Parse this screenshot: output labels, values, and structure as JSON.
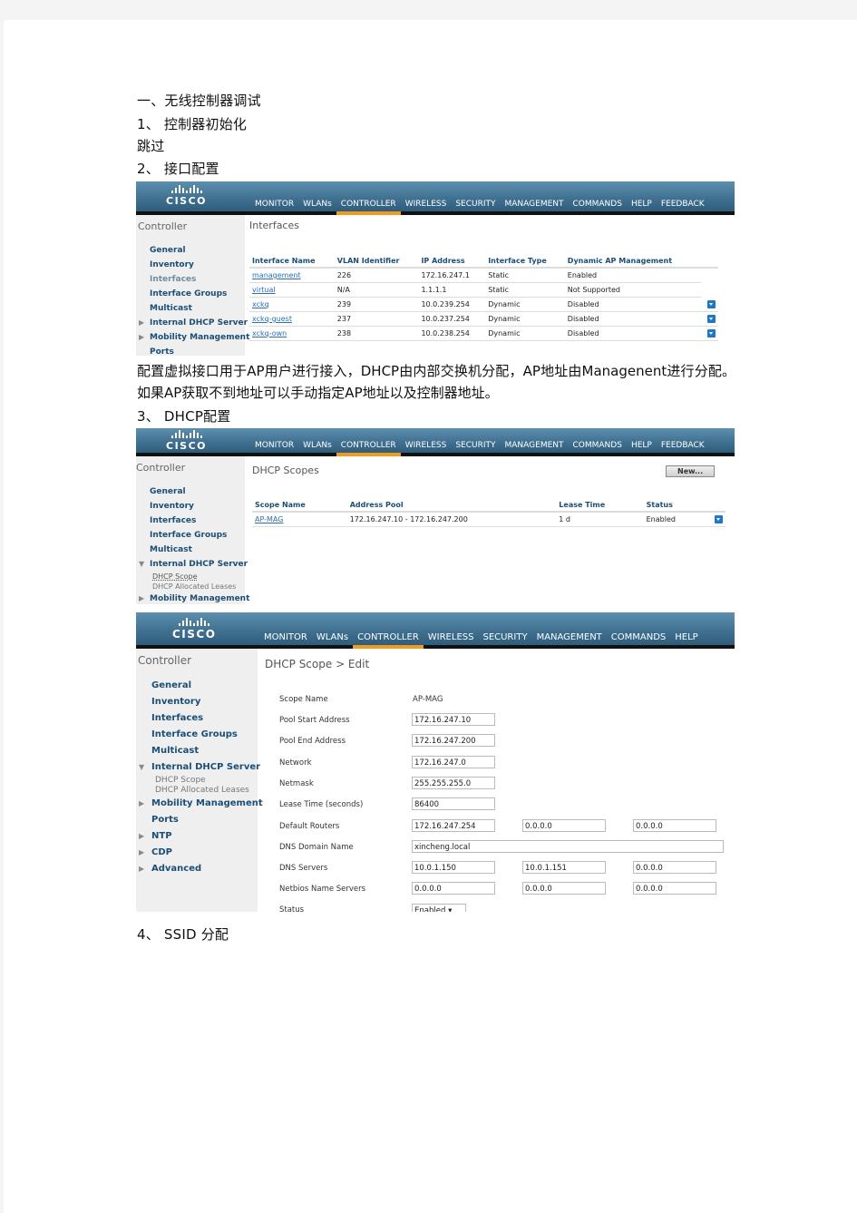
{
  "doc": {
    "heading": "一、无线控制器调试",
    "step1": "1、 控制器初始化",
    "skip": "跳过",
    "step2": "2、 接口配置",
    "para1": "配置虚拟接口用于AP用户进行接入，DHCP由内部交换机分配，AP地址由Managenent进行分配。如果AP获取不到地址可以手动指定AP地址以及控制器地址。",
    "step3": "3、 DHCP配置",
    "step4": "4、 SSID 分配"
  },
  "cisco": {
    "logo_text": "CISCO",
    "menu": [
      "MONITOR",
      "WLANs",
      "CONTROLLER",
      "WIRELESS",
      "SECURITY",
      "MANAGEMENT",
      "COMMANDS",
      "HELP",
      "FEEDBACK"
    ],
    "active_menu": "CONTROLLER",
    "sidebar_title": "Controller"
  },
  "interfaces": {
    "title": "Interfaces",
    "sidebar": [
      "General",
      "Inventory",
      "Interfaces",
      "Interface Groups",
      "Multicast",
      "Internal DHCP Server",
      "Mobility Management",
      "Ports"
    ],
    "columns": [
      "Interface Name",
      "VLAN Identifier",
      "IP Address",
      "Interface Type",
      "Dynamic AP Management"
    ],
    "rows": [
      [
        "management",
        "226",
        "172.16.247.1",
        "Static",
        "Enabled"
      ],
      [
        "virtual",
        "N/A",
        "1.1.1.1",
        "Static",
        "Not Supported"
      ],
      [
        "xckq",
        "239",
        "10.0.239.254",
        "Dynamic",
        "Disabled"
      ],
      [
        "xckq-guest",
        "237",
        "10.0.237.254",
        "Dynamic",
        "Disabled"
      ],
      [
        "xckq-own",
        "238",
        "10.0.238.254",
        "Dynamic",
        "Disabled"
      ]
    ]
  },
  "dhcp_scopes": {
    "title": "DHCP Scopes",
    "new_button": "New...",
    "sidebar": [
      "General",
      "Inventory",
      "Interfaces",
      "Interface Groups",
      "Multicast",
      "Internal DHCP Server"
    ],
    "sub": [
      "DHCP Scope",
      "DHCP Allocated Leases"
    ],
    "sidebar_cut": "Mobility Management",
    "columns": [
      "Scope Name",
      "Address Pool",
      "Lease Time",
      "Status"
    ],
    "rows": [
      [
        "AP-MAG",
        "172.16.247.10 - 172.16.247.200",
        "1 d",
        "Enabled"
      ]
    ]
  },
  "dhcp_edit": {
    "title": "DHCP Scope > Edit",
    "sidebar": [
      "General",
      "Inventory",
      "Interfaces",
      "Interface Groups",
      "Multicast",
      "Internal DHCP Server"
    ],
    "sub": [
      "DHCP Scope",
      "DHCP Allocated Leases"
    ],
    "sidebar2": [
      "Mobility Management",
      "Ports",
      "NTP",
      "CDP",
      "Advanced"
    ],
    "labels": {
      "scope_name": "Scope Name",
      "pool_start": "Pool Start Address",
      "pool_end": "Pool End Address",
      "network": "Network",
      "netmask": "Netmask",
      "lease": "Lease Time (seconds)",
      "routers": "Default Routers",
      "dns_domain": "DNS Domain Name",
      "dns_servers": "DNS Servers",
      "netbios": "Netbios Name Servers",
      "status": "Status"
    },
    "values": {
      "scope_name": "AP-MAG",
      "pool_start": "172.16.247.10",
      "pool_end": "172.16.247.200",
      "network": "172.16.247.0",
      "netmask": "255.255.255.0",
      "lease": "86400",
      "routers": [
        "172.16.247.254",
        "0.0.0.0",
        "0.0.0.0"
      ],
      "dns_domain": "xincheng.local",
      "dns_servers": [
        "10.0.1.150",
        "10.0.1.151",
        "0.0.0.0"
      ],
      "netbios": [
        "0.0.0.0",
        "0.0.0.0",
        "0.0.0.0"
      ],
      "status": "Enabled"
    }
  }
}
